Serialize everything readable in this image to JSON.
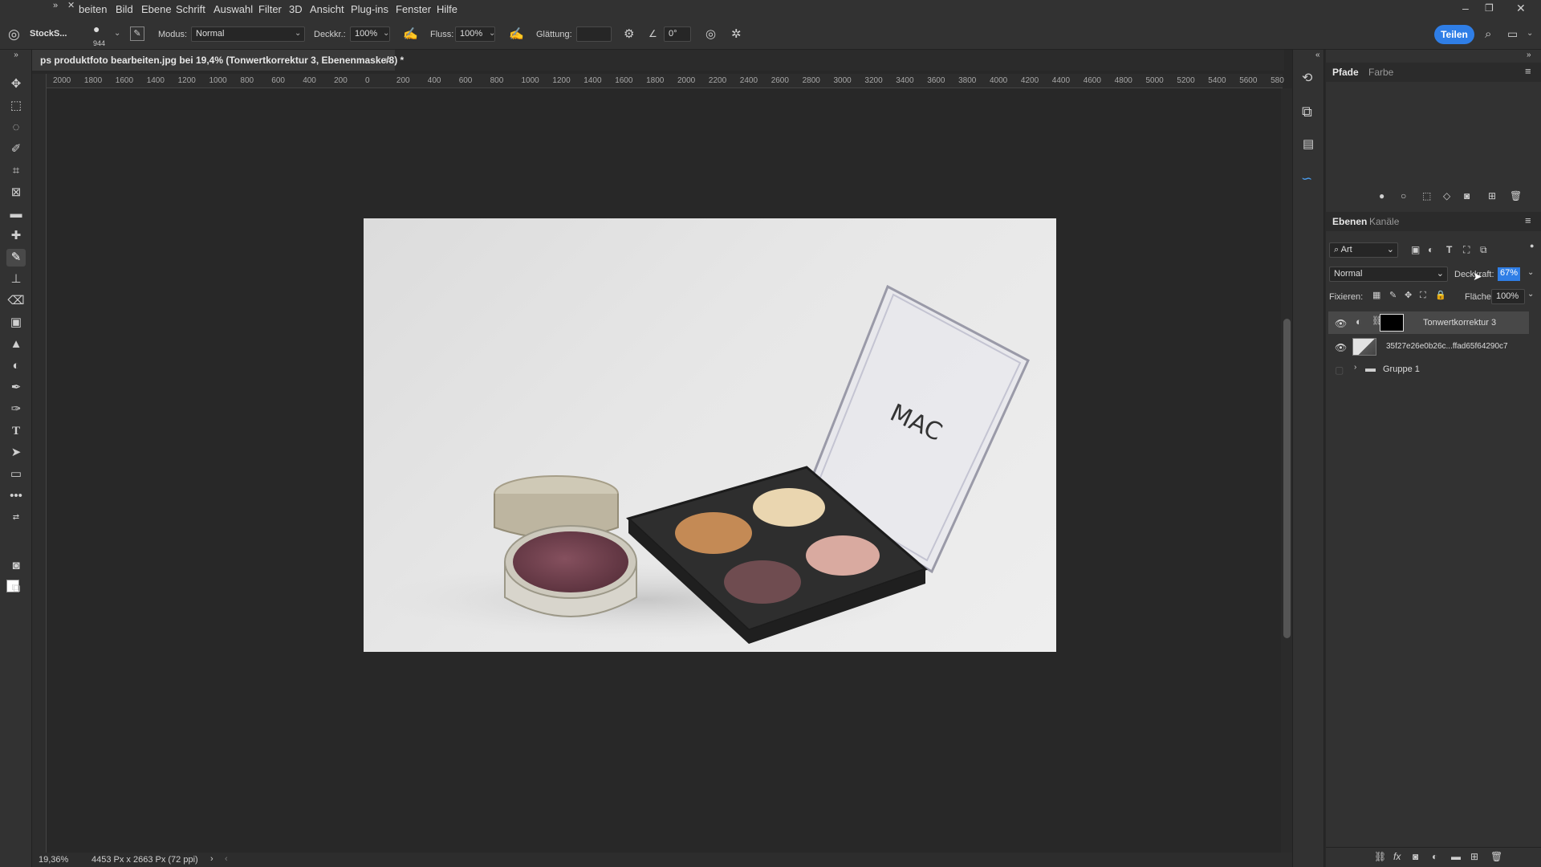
{
  "menu": {
    "items": [
      "beiten",
      "Bild",
      "Ebene",
      "Schrift",
      "Auswahl",
      "Filter",
      "3D",
      "Ansicht",
      "Plug-ins",
      "Fenster",
      "Hilfe"
    ]
  },
  "options": {
    "preset_label": "StockS...",
    "brush_size": "944",
    "mode_label": "Modus:",
    "mode_value": "Normal",
    "opacity_label": "Deckkr.:",
    "opacity_value": "100%",
    "flow_label": "Fluss:",
    "flow_value": "100%",
    "smoothing_label": "Glättung:",
    "angle_value": "0°",
    "share_label": "Teilen"
  },
  "document": {
    "tab_title": "ps produktfoto bearbeiten.jpg bei 19,4% (Tonwertkorrektur 3, Ebenenmaske/8) *",
    "close": "×"
  },
  "ruler": {
    "h_ticks": [
      "2000",
      "1800",
      "1600",
      "1400",
      "1200",
      "1000",
      "800",
      "600",
      "400",
      "200",
      "0",
      "200",
      "400",
      "600",
      "800",
      "1000",
      "1200",
      "1400",
      "1600",
      "1800",
      "2000",
      "2200",
      "2400",
      "2600",
      "2800",
      "3000",
      "3200",
      "3400",
      "3600",
      "3800",
      "4000",
      "4200",
      "4400",
      "4600",
      "4800",
      "5000",
      "5200",
      "5400",
      "5600",
      "580"
    ]
  },
  "status": {
    "zoom": "19,36%",
    "doc_size": "4453 Px x 2663 Px (72 ppi)"
  },
  "panels": {
    "top_tabs": [
      "Pfade",
      "Farbe"
    ],
    "layer_tabs": [
      "Ebenen",
      "Kanäle"
    ],
    "filter_label": "Art",
    "blend_mode": "Normal",
    "opacity_label": "Deckkraft:",
    "opacity_value": "67%",
    "lock_label": "Fixieren:",
    "fill_label": "Fläche:",
    "fill_value": "100%",
    "layers": [
      {
        "name": "Tonwertkorrektur 3"
      },
      {
        "name": "35f27e26e0b26c...ffad65f64290c7"
      },
      {
        "name": "Gruppe 1"
      }
    ]
  },
  "photo": {
    "brand_text": "MAC"
  },
  "colors": {
    "accent": "#2f7ee6",
    "panel_bg": "#323232",
    "canvas_bg": "#282828"
  }
}
